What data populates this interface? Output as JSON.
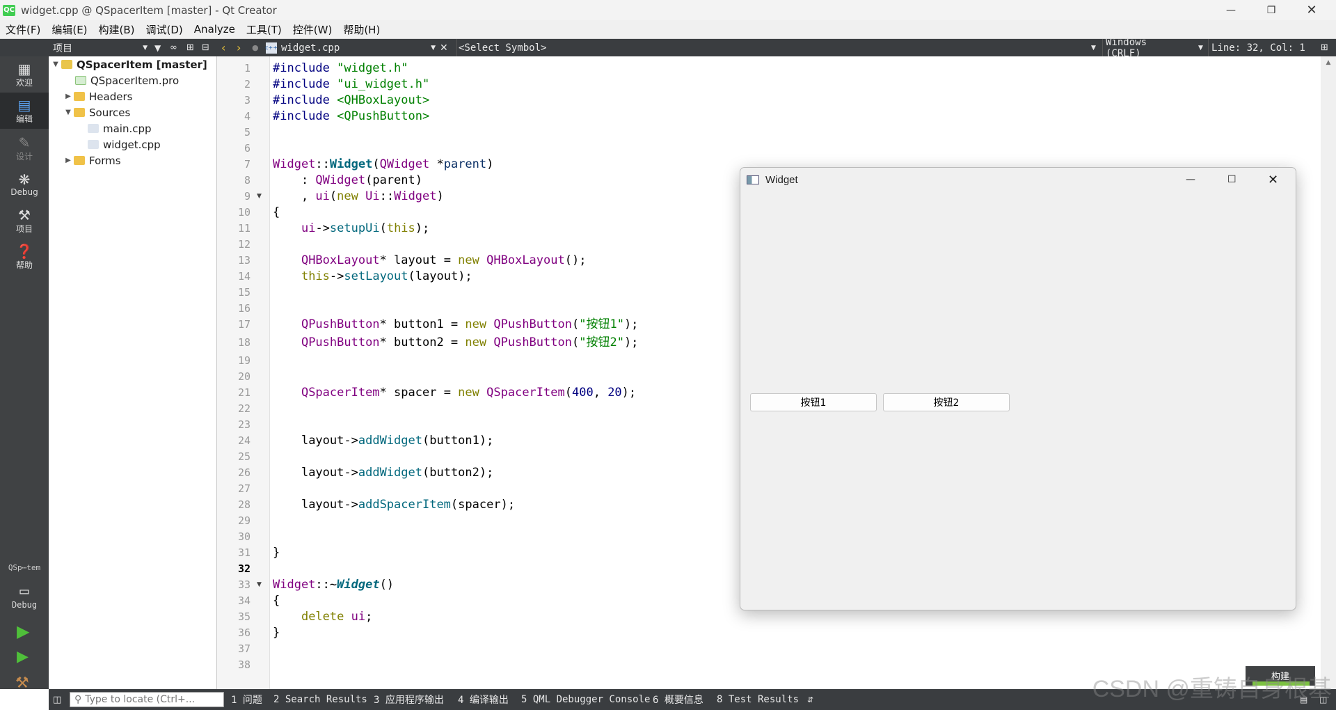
{
  "window": {
    "title": "widget.cpp @ QSpacerItem [master] - Qt Creator",
    "app_icon": "QC"
  },
  "menu": [
    "文件(F)",
    "编辑(E)",
    "构建(B)",
    "调试(D)",
    "Analyze",
    "工具(T)",
    "控件(W)",
    "帮助(H)"
  ],
  "toolbar": {
    "projects_label": "项目",
    "file_name": "widget.cpp",
    "symbol": "<Select Symbol>",
    "line_ending": "Windows (CRLF)",
    "position": "Line: 32, Col: 1"
  },
  "modes": [
    "欢迎",
    "编辑",
    "设计",
    "Debug",
    "项目",
    "帮助"
  ],
  "kit": {
    "name": "QSp⋯tem",
    "mode": "Debug"
  },
  "tree": {
    "project": "QSpacerItem [master]",
    "pro_file": "QSpacerItem.pro",
    "headers": "Headers",
    "sources": "Sources",
    "main": "main.cpp",
    "widget": "widget.cpp",
    "forms": "Forms"
  },
  "editor": {
    "current_line": 32
  },
  "code": [
    "#include \"widget.h\"",
    "#include \"ui_widget.h\"",
    "#include <QHBoxLayout>",
    "#include <QPushButton>",
    "",
    "",
    "Widget::Widget(QWidget *parent)",
    "    : QWidget(parent)",
    "    , ui(new Ui::Widget)",
    "{",
    "    ui->setupUi(this);",
    "",
    "    QHBoxLayout* layout = new QHBoxLayout();",
    "    this->setLayout(layout);",
    "",
    "",
    "    QPushButton* button1 = new QPushButton(\"按钮1\");",
    "    QPushButton* button2 = new QPushButton(\"按钮2\");",
    "",
    "",
    "    QSpacerItem* spacer = new QSpacerItem(400, 20);",
    "",
    "",
    "    layout->addWidget(button1);",
    "",
    "    layout->addWidget(button2);",
    "",
    "    layout->addSpacerItem(spacer);",
    "",
    "",
    "}",
    "",
    "Widget::~Widget()",
    "{",
    "    delete ui;",
    "}",
    "",
    ""
  ],
  "preview": {
    "title": "Widget",
    "button1": "按钮1",
    "button2": "按钮2"
  },
  "output_tabs": [
    "1 问题",
    "2 Search Results",
    "3 应用程序输出",
    "4 编译输出",
    "5 QML Debugger Console",
    "6 概要信息",
    "8 Test Results"
  ],
  "locator_placeholder": "Type to locate (Ctrl+...",
  "build_label": "构建",
  "watermark": "CSDN @重铸自身根基"
}
